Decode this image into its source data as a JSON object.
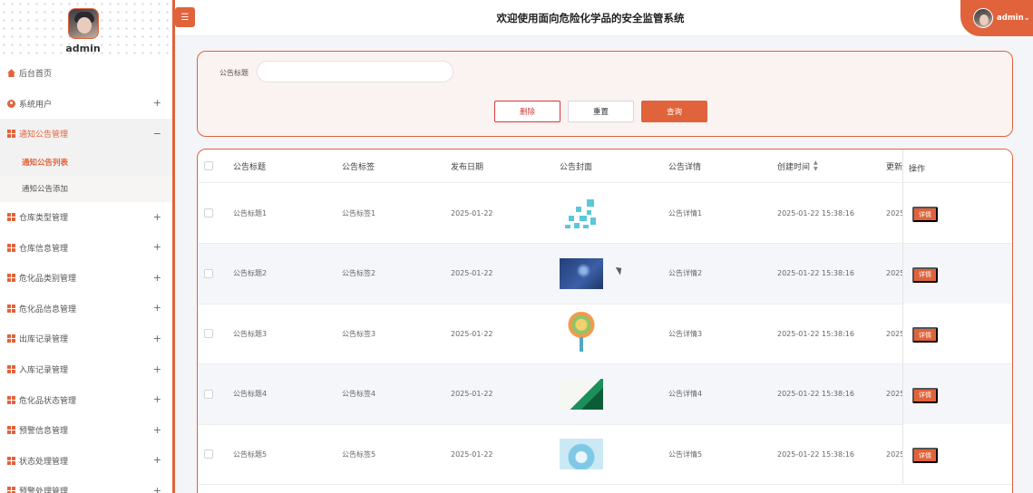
{
  "app": {
    "title": "欢迎使用面向危险化学品的安全监管系统",
    "toggle_icon": "menu-icon",
    "accent_color": "#e0633b"
  },
  "sidebar": {
    "username": "admin",
    "items": [
      {
        "label": "后台首页",
        "icon": "home-icon",
        "expandable": false
      },
      {
        "label": "系统用户",
        "icon": "user-icon",
        "expandable": true,
        "toggle": "+"
      },
      {
        "label": "通知公告管理",
        "icon": "grid-icon",
        "expandable": true,
        "toggle": "−",
        "active": true,
        "children": [
          {
            "label": "通知公告列表",
            "current": true
          },
          {
            "label": "通知公告添加",
            "current": false
          }
        ]
      },
      {
        "label": "仓库类型管理",
        "icon": "grid-icon",
        "expandable": true,
        "toggle": "+"
      },
      {
        "label": "仓库信息管理",
        "icon": "grid-icon",
        "expandable": true,
        "toggle": "+"
      },
      {
        "label": "危化品类别管理",
        "icon": "grid-icon",
        "expandable": true,
        "toggle": "+"
      },
      {
        "label": "危化品信息管理",
        "icon": "grid-icon",
        "expandable": true,
        "toggle": "+"
      },
      {
        "label": "出库记录管理",
        "icon": "grid-icon",
        "expandable": true,
        "toggle": "+"
      },
      {
        "label": "入库记录管理",
        "icon": "grid-icon",
        "expandable": true,
        "toggle": "+"
      },
      {
        "label": "危化品状态管理",
        "icon": "grid-icon",
        "expandable": true,
        "toggle": "+"
      },
      {
        "label": "预警信息管理",
        "icon": "grid-icon",
        "expandable": true,
        "toggle": "+"
      },
      {
        "label": "状态处理管理",
        "icon": "grid-icon",
        "expandable": true,
        "toggle": "+"
      },
      {
        "label": "预警处理管理",
        "icon": "grid-icon",
        "expandable": true,
        "toggle": "+"
      }
    ]
  },
  "header": {
    "username": "admin",
    "dropdown_icon": "chevron-down-icon"
  },
  "search": {
    "label": "公告标题",
    "value": "",
    "delete_label": "删除",
    "reset_label": "重置",
    "search_label": "查询"
  },
  "table": {
    "columns": [
      "公告标题",
      "公告标签",
      "发布日期",
      "公告封面",
      "公告详情",
      "创建时间",
      "更新",
      "操作"
    ],
    "sort_icon": "sort-icon",
    "detail_label": "详情",
    "rows": [
      {
        "title": "公告标题1",
        "tag": "公告标签1",
        "date": "2025-01-22",
        "cover": "qr-cover",
        "detail": "公告详情1",
        "created": "2025-01-22 15:38:16",
        "updated": "2025"
      },
      {
        "title": "公告标题2",
        "tag": "公告标签2",
        "date": "2025-01-22",
        "cover": "blue-cover",
        "detail": "公告详情2",
        "created": "2025-01-22 15:38:16",
        "updated": "2025"
      },
      {
        "title": "公告标题3",
        "tag": "公告标签3",
        "date": "2025-01-22",
        "cover": "tree-cover",
        "detail": "公告详情3",
        "created": "2025-01-22 15:38:16",
        "updated": "2025"
      },
      {
        "title": "公告标题4",
        "tag": "公告标签4",
        "date": "2025-01-22",
        "cover": "green-cover",
        "detail": "公告详情4",
        "created": "2025-01-22 15:38:16",
        "updated": "2025"
      },
      {
        "title": "公告标题5",
        "tag": "公告标签5",
        "date": "2025-01-22",
        "cover": "ice-cover",
        "detail": "公告详情5",
        "created": "2025-01-22 15:38:16",
        "updated": "2025"
      }
    ]
  }
}
